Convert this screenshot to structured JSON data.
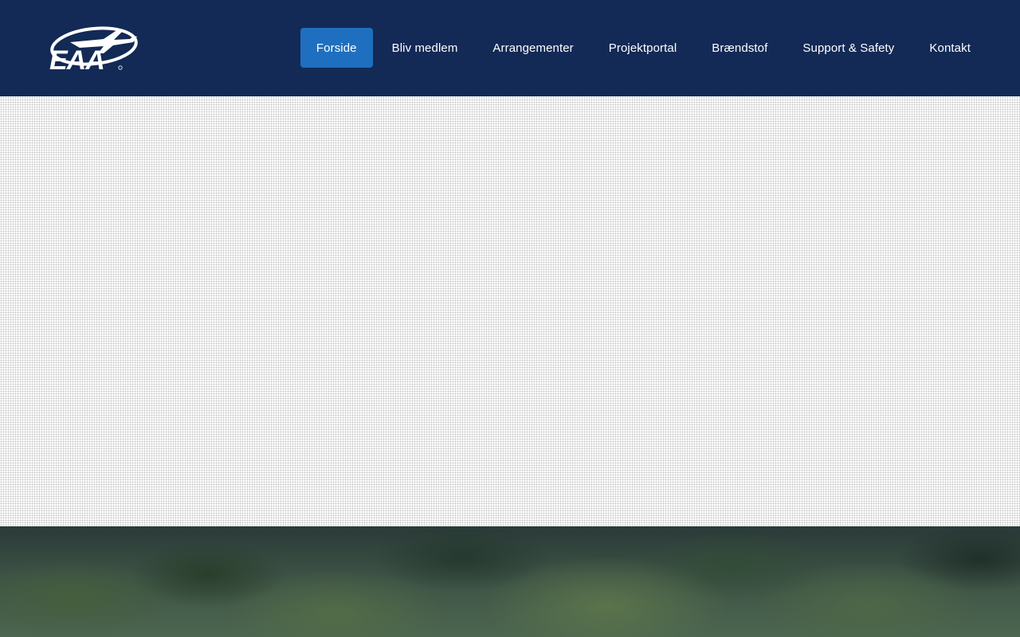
{
  "logo": {
    "text": "EAA",
    "mark": "airplane-swoosh"
  },
  "nav": {
    "items": [
      {
        "label": "Forside",
        "active": true
      },
      {
        "label": "Bliv medlem",
        "active": false
      },
      {
        "label": "Arrangementer",
        "active": false
      },
      {
        "label": "Projektportal",
        "active": false
      },
      {
        "label": "Brændstof",
        "active": false
      },
      {
        "label": "Support & Safety",
        "active": false
      },
      {
        "label": "Kontakt",
        "active": false
      }
    ]
  },
  "colors": {
    "header_bg": "#132a56",
    "active_nav_bg": "#1f6fc0",
    "nav_text": "#ffffff"
  }
}
